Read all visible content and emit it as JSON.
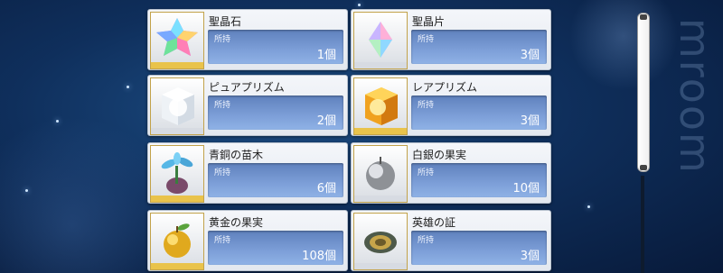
{
  "watermark": "mroom",
  "items": [
    {
      "name": "聖晶石",
      "label": "所持",
      "qty": "1個",
      "icon": "saint-quartz-icon"
    },
    {
      "name": "聖晶片",
      "label": "所持",
      "qty": "3個",
      "icon": "quartz-fragment-icon"
    },
    {
      "name": "ピュアプリズム",
      "label": "所持",
      "qty": "2個",
      "icon": "pure-prism-icon"
    },
    {
      "name": "レアプリズム",
      "label": "所持",
      "qty": "3個",
      "icon": "rare-prism-icon"
    },
    {
      "name": "青銅の苗木",
      "label": "所持",
      "qty": "6個",
      "icon": "bronze-sapling-icon"
    },
    {
      "name": "白銀の果実",
      "label": "所持",
      "qty": "10個",
      "icon": "silver-fruit-icon"
    },
    {
      "name": "黄金の果実",
      "label": "所持",
      "qty": "108個",
      "icon": "golden-fruit-icon"
    },
    {
      "name": "英雄の証",
      "label": "所持",
      "qty": "3個",
      "icon": "heroic-proof-icon"
    }
  ]
}
